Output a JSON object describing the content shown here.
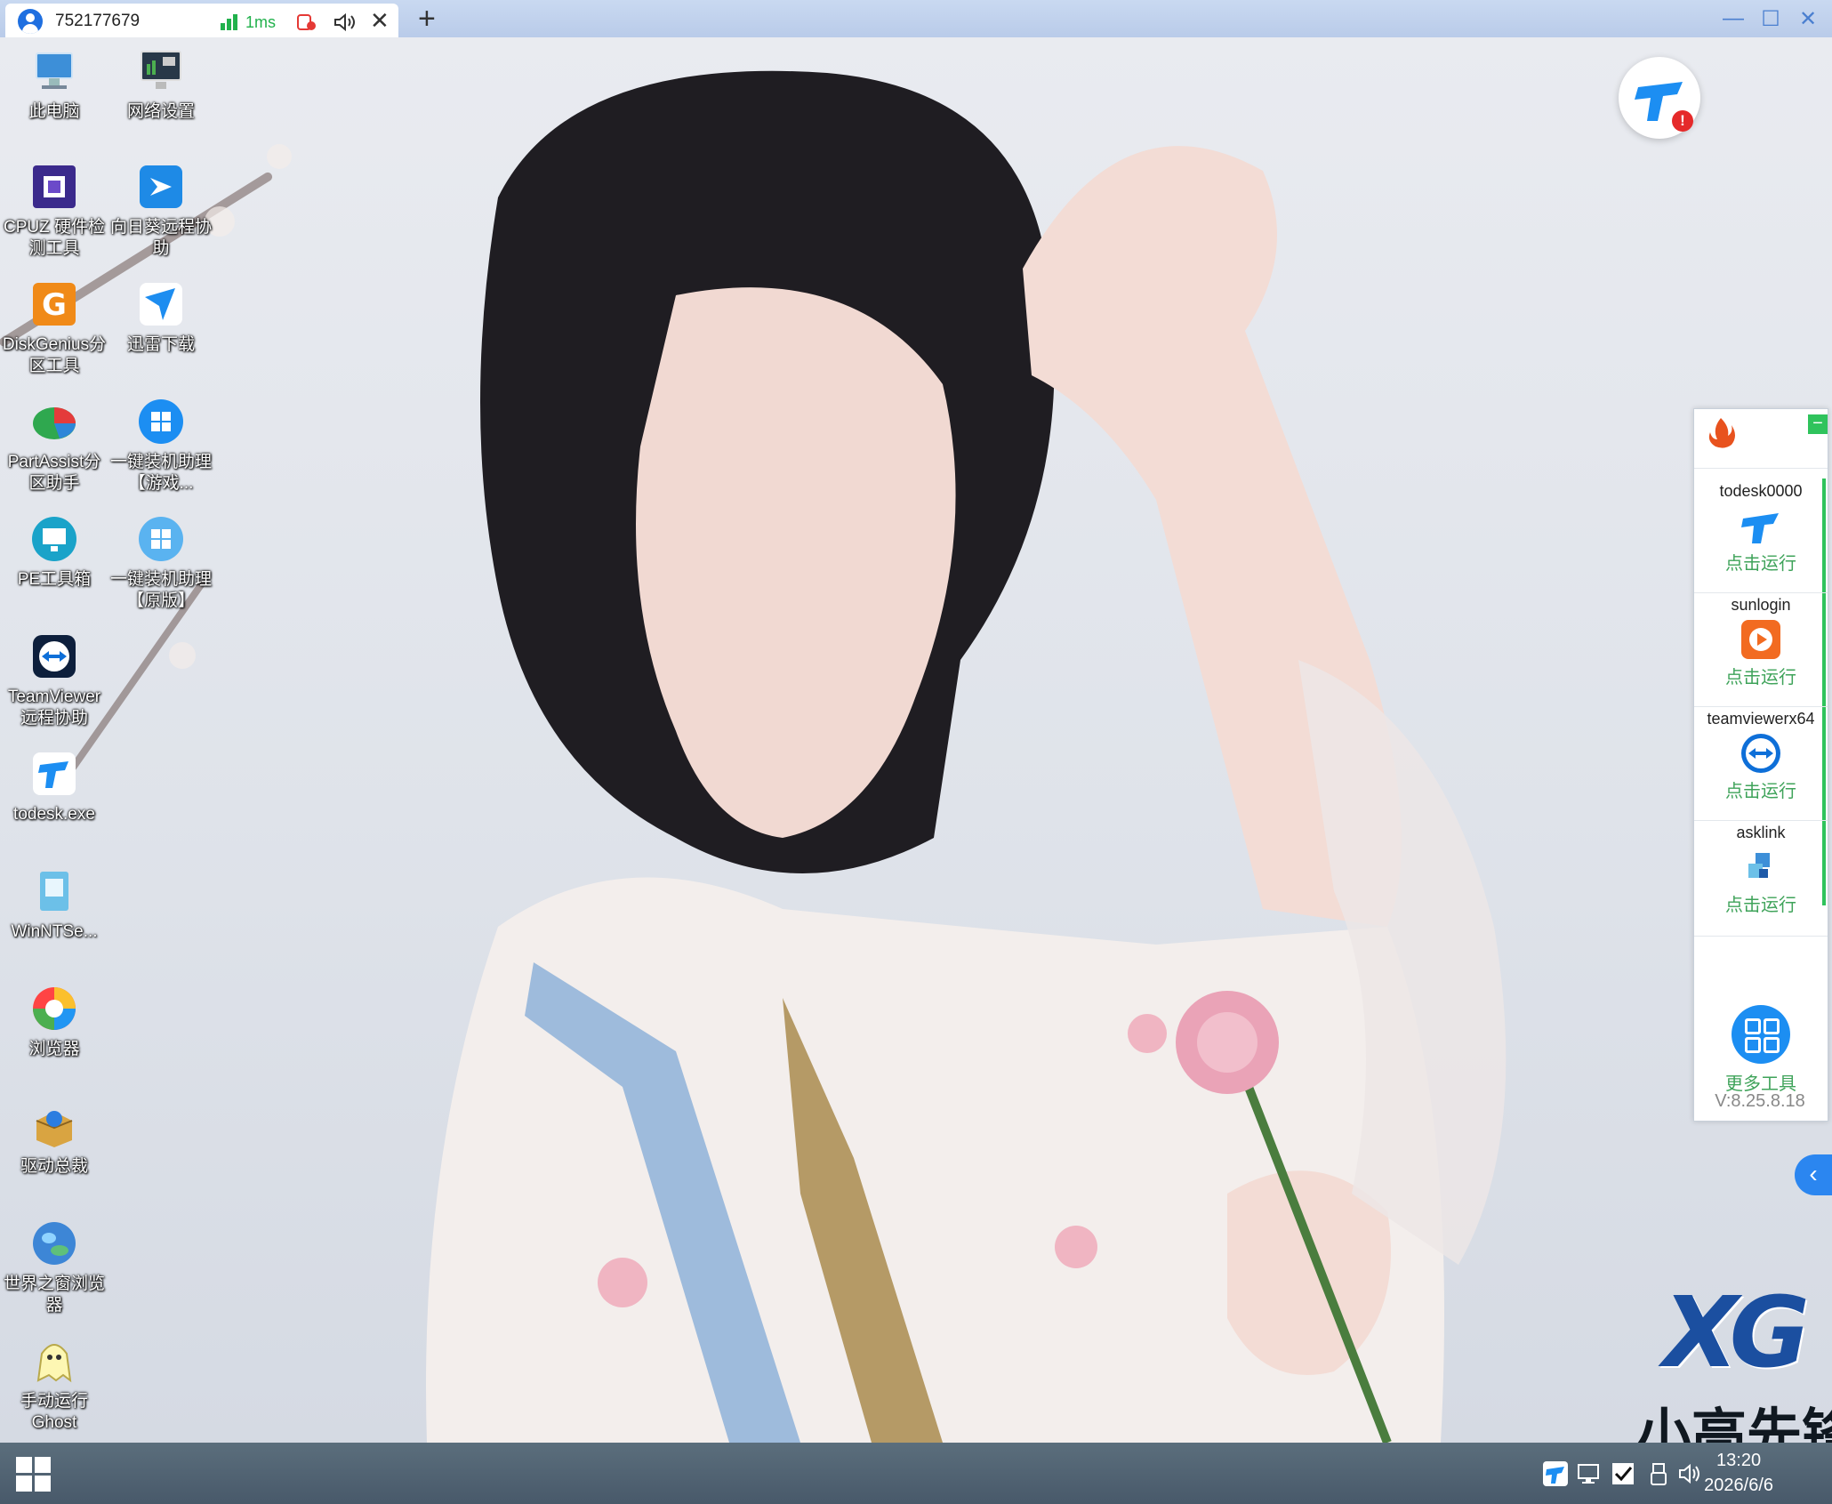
{
  "session_tab": {
    "device_code": "752177679",
    "latency": "1ms",
    "add_tab": "+",
    "close": "✕"
  },
  "window_controls": {
    "minimize": "—",
    "maximize": "☐",
    "close": "✕"
  },
  "desktop_icons": [
    {
      "label": "此电脑",
      "icon": "computer-icon"
    },
    {
      "label": "网络设置",
      "icon": "network-settings-icon"
    },
    {
      "label": "CPUZ 硬件检测工具",
      "icon": "cpuz-icon"
    },
    {
      "label": "向日葵远程协助",
      "icon": "sunflower-remote-icon"
    },
    {
      "label": "DiskGenius分区工具",
      "icon": "diskgenius-icon"
    },
    {
      "label": "迅雷下载",
      "icon": "thunder-download-icon"
    },
    {
      "label": "PartAssist分区助手",
      "icon": "partassist-icon"
    },
    {
      "label": "一键装机助理【游戏...",
      "icon": "install-assistant-game-icon"
    },
    {
      "label": "PE工具箱",
      "icon": "pe-toolbox-icon"
    },
    {
      "label": "一键装机助理【原版】",
      "icon": "install-assistant-original-icon"
    },
    {
      "label": "TeamViewer远程协助",
      "icon": "teamviewer-icon"
    },
    {
      "label": "todesk.exe",
      "icon": "todesk-icon"
    },
    {
      "label": "WinNTSe...",
      "icon": "winntsetup-icon"
    },
    {
      "label": "浏览器",
      "icon": "browser-icon"
    },
    {
      "label": "驱动总裁",
      "icon": "driver-icon"
    },
    {
      "label": "世界之窗浏览器",
      "icon": "theworld-browser-icon"
    },
    {
      "label": "手动运行Ghost",
      "icon": "ghost-icon"
    }
  ],
  "side_panel": {
    "minimize": "−",
    "tools": [
      {
        "name": "todesk0000",
        "action": "点击运行",
        "icon": "todesk-icon"
      },
      {
        "name": "sunlogin",
        "action": "点击运行",
        "icon": "sunlogin-icon"
      },
      {
        "name": "teamviewerx64",
        "action": "点击运行",
        "icon": "teamviewer-icon"
      },
      {
        "name": "asklink",
        "action": "点击运行",
        "icon": "asklink-icon"
      }
    ],
    "more_tools": "更多工具",
    "version": "V:8.25.8.18",
    "collapse": "‹"
  },
  "logo": {
    "mark": "XG",
    "text": "小高先锋"
  },
  "taskbar": {
    "time": "13:20",
    "date": "2026/6/6"
  },
  "colors": {
    "accent": "#1c8ef2",
    "run_green": "#3fa35a",
    "signal_green": "#21b14c",
    "alert_red": "#e52a2a",
    "taskbar": "#4f6171"
  }
}
